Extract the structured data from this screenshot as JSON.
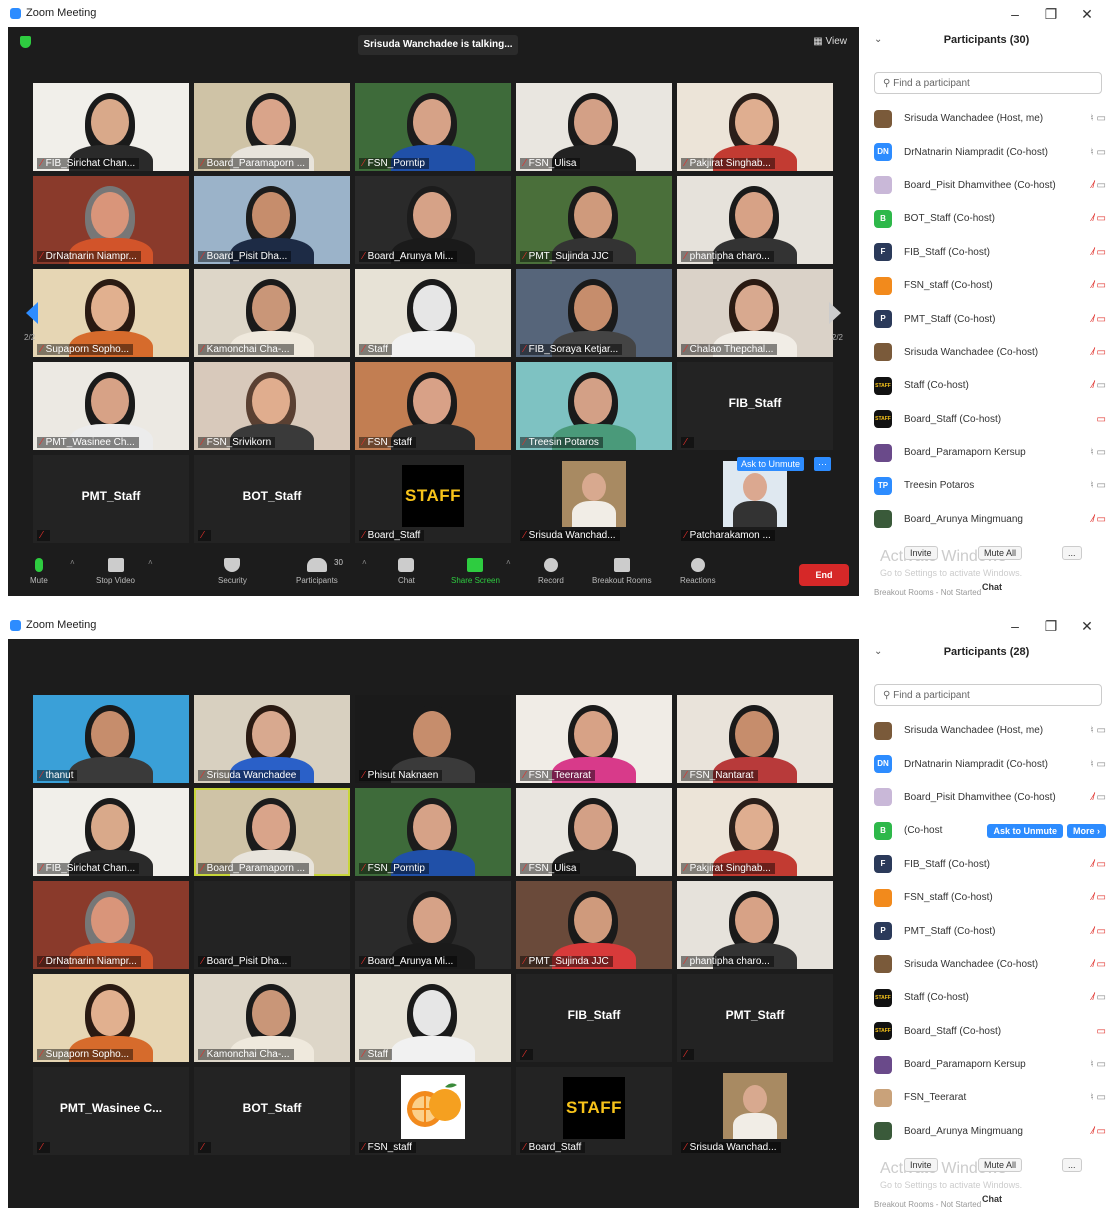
{
  "window": {
    "title": "Zoom Meeting"
  },
  "screen1": {
    "talking": "Srisuda Wanchadee is talking...",
    "view_label": "View",
    "page_left": "2/2",
    "page_right": "2/2",
    "tiles": [
      {
        "name": "FIB_Sirichat Chan...",
        "type": "video",
        "skin": "#d9a98a",
        "bg": "#f1efea",
        "hair": "#1a1a1a",
        "shirt": "#2a2a2a"
      },
      {
        "name": "Board_Paramaporn ...",
        "type": "video",
        "skin": "#d9a48a",
        "bg": "#cfc3a6",
        "hair": "#1c1c1c",
        "shirt": "#e8e4dc"
      },
      {
        "name": "FSN_Porntip",
        "type": "video",
        "skin": "#d6a287",
        "bg": "#3e6b3a",
        "hair": "#1c1c1c",
        "shirt": "#2050a8"
      },
      {
        "name": "FSN_Ulisa",
        "type": "video",
        "skin": "#d3a086",
        "bg": "#e9e6e0",
        "hair": "#1a1a1a",
        "shirt": "#222"
      },
      {
        "name": "Pakjirat Singhab...",
        "type": "video",
        "skin": "#dfae90",
        "bg": "#ece4d8",
        "hair": "#2a1f1a",
        "shirt": "#c23b32"
      },
      {
        "name": "DrNatnarin Niampr...",
        "type": "video",
        "skin": "#d9957a",
        "bg": "#8a3a2b",
        "hair": "#777",
        "shirt": "#d2542a"
      },
      {
        "name": "Board_Pisit Dha...",
        "type": "video",
        "skin": "#c68d6c",
        "bg": "#9bb3c9",
        "hair": "#1c1c1c",
        "shirt": "#1d2b45"
      },
      {
        "name": "Board_Arunya Mi...",
        "type": "video",
        "skin": "#d6a287",
        "bg": "#2a2a2a",
        "hair": "#1c1c1c",
        "shirt": "#1a1a1a"
      },
      {
        "name": "PMT_Sujinda JJC",
        "type": "video",
        "skin": "#cf9a7c",
        "bg": "#4a6f3a",
        "hair": "#1a1a1a",
        "shirt": "#333"
      },
      {
        "name": "phantipha charo...",
        "type": "video",
        "skin": "#d7a286",
        "bg": "#e6e2db",
        "hair": "#1a1a1a",
        "shirt": "#333"
      },
      {
        "name": "Supaporn Sopho...",
        "type": "video",
        "skin": "#e1b08f",
        "bg": "#e6d6b4",
        "hair": "#2a1a12",
        "shirt": "#d66b2c"
      },
      {
        "name": "Kamonchai Cha-...",
        "type": "video",
        "skin": "#c99678",
        "bg": "#ddd6c8",
        "hair": "#1a1a1a",
        "shirt": "#efe9dd"
      },
      {
        "name": "Staff",
        "type": "video",
        "skin": "#e6e6e6",
        "bg": "#e7e2d6",
        "hair": "#1a1a1a",
        "shirt": "#f1f1f1"
      },
      {
        "name": "FIB_Soraya Ketjar...",
        "type": "video",
        "skin": "#c68d6c",
        "bg": "#56657a",
        "hair": "#1a1a1a",
        "shirt": "#444"
      },
      {
        "name": "Chalao Thepchal...",
        "type": "video",
        "skin": "#d8a98f",
        "bg": "#dad2c8",
        "hair": "#2a1a12",
        "shirt": "#f1ede6"
      },
      {
        "name": "PMT_Wasinee Ch...",
        "type": "video",
        "skin": "#d7a286",
        "bg": "#ece9e3",
        "hair": "#1a1a1a",
        "shirt": "#ececec"
      },
      {
        "name": "FSN_Srivikorn",
        "type": "video",
        "skin": "#e0ad8e",
        "bg": "#d8c9bb",
        "hair": "#5a4032",
        "shirt": "#3a3a3a"
      },
      {
        "name": "FSN_staff",
        "type": "video",
        "skin": "#d8a187",
        "bg": "#c27e52",
        "hair": "#1a1a1a",
        "shirt": "#2a2a2a"
      },
      {
        "name": "Treesin Potaros",
        "type": "video",
        "skin": "#d3a086",
        "bg": "#7ec2c2",
        "hair": "#1a1a1a",
        "shirt": "#4a9a7a"
      },
      {
        "name": "FIB_Staff",
        "type": "name"
      },
      {
        "name": "PMT_Staff",
        "type": "name"
      },
      {
        "name": "BOT_Staff",
        "type": "name"
      },
      {
        "name": "Board_Staff",
        "type": "staff"
      },
      {
        "name": "Srisuda Wanchad...",
        "type": "photo",
        "skin": "#d8a98f",
        "bg": "#a88a62",
        "hair": "#2a1a12",
        "shirt": "#f1ede6"
      },
      {
        "name": "Patcharakamon ...",
        "type": "photo",
        "skin": "#dba890",
        "bg": "#dfe8f0",
        "hair": "#1a1a1a",
        "shirt": "#333"
      }
    ],
    "ask_to_unmute": "Ask to Unmute",
    "more_dots": "···",
    "toolbar": {
      "mute": "Mute",
      "stop_video": "Stop Video",
      "security": "Security",
      "participants": "Participants",
      "participants_count": "30",
      "chat": "Chat",
      "share_screen": "Share Screen",
      "record": "Record",
      "breakout_rooms": "Breakout Rooms",
      "reactions": "Reactions",
      "end": "End"
    },
    "panel": {
      "title": "Participants (30)",
      "search_placeholder": "Find a participant",
      "participants": [
        {
          "name": "Srisuda Wanchadee (Host, me)",
          "av_text": "",
          "av_color": "#7a5a3a",
          "mic": "on",
          "cam": "on"
        },
        {
          "name": "DrNatnarin Niampradit (Co-host)",
          "av_text": "DN",
          "av_color": "#2d8cff",
          "mic": "on",
          "cam": "on"
        },
        {
          "name": "Board_Pisit Dhamvithee (Co-host)",
          "av_text": "",
          "av_color": "#c9b8d8",
          "mic": "off",
          "cam": "on"
        },
        {
          "name": "BOT_Staff (Co-host)",
          "av_text": "B",
          "av_color": "#2eb84a",
          "mic": "off",
          "cam": "off"
        },
        {
          "name": "FIB_Staff (Co-host)",
          "av_text": "F",
          "av_color": "#2b3a5a",
          "mic": "off",
          "cam": "off"
        },
        {
          "name": "FSN_staff (Co-host)",
          "av_text": "",
          "av_color": "#f28a1c",
          "mic": "off",
          "cam": "off"
        },
        {
          "name": "PMT_Staff (Co-host)",
          "av_text": "P",
          "av_color": "#2b3a5a",
          "mic": "off",
          "cam": "off"
        },
        {
          "name": "Srisuda Wanchadee (Co-host)",
          "av_text": "",
          "av_color": "#7a5a3a",
          "mic": "off",
          "cam": "off"
        },
        {
          "name": "Staff (Co-host)",
          "av_text": "STAFF",
          "av_color": "#111111",
          "mic": "off",
          "cam": "on"
        },
        {
          "name": "Board_Staff (Co-host)",
          "av_text": "STAFF",
          "av_color": "#111111",
          "mic": "",
          "cam": "off"
        },
        {
          "name": "Board_Paramaporn Kersup",
          "av_text": "",
          "av_color": "#6a4a8a",
          "mic": "on",
          "cam": "on"
        },
        {
          "name": "Treesin Potaros",
          "av_text": "TP",
          "av_color": "#2d8cff",
          "mic": "on",
          "cam": "on"
        },
        {
          "name": "Board_Arunya Mingmuang",
          "av_text": "",
          "av_color": "#3a5a3a",
          "mic": "off",
          "cam": "off"
        }
      ],
      "activate": "Activate Windows",
      "goto": "Go to Settings to activate Windows.",
      "invite": "Invite",
      "mute_all": "Mute All",
      "more": "...",
      "chat": "Chat",
      "breakout": "Breakout Rooms - Not Started"
    }
  },
  "screen2": {
    "tiles": [
      {
        "name": "thanut",
        "type": "video",
        "skin": "#c68d6c",
        "bg": "#3aa0d8",
        "hair": "#1a1a1a",
        "shirt": "#3a3a3a"
      },
      {
        "name": "Srisuda Wanchadee",
        "type": "video",
        "skin": "#d8a98f",
        "bg": "#d8d0c0",
        "hair": "#2a1a12",
        "shirt": "#2a60c8"
      },
      {
        "name": "Phisut Naknaen",
        "type": "video",
        "skin": "#c68d6c",
        "bg": "#1a1a1a",
        "hair": "#1a1a1a",
        "shirt": "#3a3a3a"
      },
      {
        "name": "FSN_Teerarat",
        "type": "video",
        "skin": "#d7a286",
        "bg": "#f0ece6",
        "hair": "#1a1a1a",
        "shirt": "#d83a8a"
      },
      {
        "name": "FSN_Nantarat",
        "type": "video",
        "skin": "#c68d6c",
        "bg": "#e9e3da",
        "hair": "#1a1a1a",
        "shirt": "#b83a3a"
      },
      {
        "name": "FIB_Sirichat Chan...",
        "type": "video",
        "skin": "#d9a98a",
        "bg": "#f1efea",
        "hair": "#1a1a1a",
        "shirt": "#2a2a2a"
      },
      {
        "name": "Board_Paramaporn ...",
        "type": "video",
        "skin": "#d9a48a",
        "bg": "#cfc3a6",
        "hair": "#1c1c1c",
        "shirt": "#e8e4dc",
        "highlight": true
      },
      {
        "name": "FSN_Porntip",
        "type": "video",
        "skin": "#d6a287",
        "bg": "#3e6b3a",
        "hair": "#1c1c1c",
        "shirt": "#2050a8"
      },
      {
        "name": "FSN_Ulisa",
        "type": "video",
        "skin": "#d3a086",
        "bg": "#e9e6e0",
        "hair": "#1a1a1a",
        "shirt": "#222"
      },
      {
        "name": "Pakjirat Singhab...",
        "type": "video",
        "skin": "#dfae90",
        "bg": "#ece4d8",
        "hair": "#2a1f1a",
        "shirt": "#c23b32"
      },
      {
        "name": "DrNatnarin Niampr...",
        "type": "video",
        "skin": "#d9957a",
        "bg": "#8a3a2b",
        "hair": "#777",
        "shirt": "#d2542a"
      },
      {
        "name": "Board_Pisit Dha...",
        "type": "blank"
      },
      {
        "name": "Board_Arunya Mi...",
        "type": "video",
        "skin": "#d6a287",
        "bg": "#2a2a2a",
        "hair": "#1c1c1c",
        "shirt": "#1a1a1a"
      },
      {
        "name": "PMT_Sujinda JJC",
        "type": "video",
        "skin": "#cf9a7c",
        "bg": "#6a4a3a",
        "hair": "#1a1a1a",
        "shirt": "#d83a3a"
      },
      {
        "name": "phantipha charo...",
        "type": "video",
        "skin": "#d7a286",
        "bg": "#e6e2db",
        "hair": "#1a1a1a",
        "shirt": "#333"
      },
      {
        "name": "Supaporn Sopho...",
        "type": "video",
        "skin": "#e1b08f",
        "bg": "#e6d6b4",
        "hair": "#2a1a12",
        "shirt": "#d66b2c"
      },
      {
        "name": "Kamonchai Cha-...",
        "type": "video",
        "skin": "#c99678",
        "bg": "#ddd6c8",
        "hair": "#1a1a1a",
        "shirt": "#efe9dd"
      },
      {
        "name": "Staff",
        "type": "video",
        "skin": "#e6e6e6",
        "bg": "#e7e2d6",
        "hair": "#1a1a1a",
        "shirt": "#f1f1f1"
      },
      {
        "name": "FIB_Staff",
        "type": "name"
      },
      {
        "name": "PMT_Staff",
        "type": "name"
      },
      {
        "name": "PMT_Wasinee C...",
        "type": "name"
      },
      {
        "name": "BOT_Staff",
        "type": "name"
      },
      {
        "name": "FSN_staff",
        "type": "orange"
      },
      {
        "name": "Board_Staff",
        "type": "staff"
      },
      {
        "name": "Srisuda Wanchad...",
        "type": "photo",
        "skin": "#d8a98f",
        "bg": "#a88a62",
        "hair": "#2a1a12",
        "shirt": "#f1ede6"
      }
    ],
    "panel": {
      "title": "Participants (28)",
      "search_placeholder": "Find a participant",
      "participants": [
        {
          "name": "Srisuda Wanchadee (Host, me)",
          "av_text": "",
          "av_color": "#7a5a3a",
          "mic": "on",
          "cam": "on"
        },
        {
          "name": "DrNatnarin Niampradit (Co-host)",
          "av_text": "DN",
          "av_color": "#2d8cff",
          "mic": "on",
          "cam": "on"
        },
        {
          "name": "Board_Pisit Dhamvithee (Co-host)",
          "av_text": "",
          "av_color": "#c9b8d8",
          "mic": "off",
          "cam": "on"
        },
        {
          "name": "(Co-host",
          "av_text": "B",
          "av_color": "#2eb84a",
          "mic": "",
          "cam": "",
          "ask": "Ask to Unmute",
          "more": "More ›"
        },
        {
          "name": "FIB_Staff (Co-host)",
          "av_text": "F",
          "av_color": "#2b3a5a",
          "mic": "off",
          "cam": "off"
        },
        {
          "name": "FSN_staff (Co-host)",
          "av_text": "",
          "av_color": "#f28a1c",
          "mic": "off",
          "cam": "off"
        },
        {
          "name": "PMT_Staff (Co-host)",
          "av_text": "P",
          "av_color": "#2b3a5a",
          "mic": "off",
          "cam": "off"
        },
        {
          "name": "Srisuda Wanchadee (Co-host)",
          "av_text": "",
          "av_color": "#7a5a3a",
          "mic": "off",
          "cam": "off"
        },
        {
          "name": "Staff (Co-host)",
          "av_text": "STAFF",
          "av_color": "#111111",
          "mic": "off",
          "cam": "on"
        },
        {
          "name": "Board_Staff (Co-host)",
          "av_text": "STAFF",
          "av_color": "#111111",
          "mic": "",
          "cam": "off"
        },
        {
          "name": "Board_Paramaporn Kersup",
          "av_text": "",
          "av_color": "#6a4a8a",
          "mic": "on",
          "cam": "on"
        },
        {
          "name": "FSN_Teerarat",
          "av_text": "",
          "av_color": "#c9a27a",
          "mic": "on",
          "cam": "on"
        },
        {
          "name": "Board_Arunya Mingmuang",
          "av_text": "",
          "av_color": "#3a5a3a",
          "mic": "off",
          "cam": "off"
        }
      ],
      "activate": "Activate Windows",
      "goto": "Go to Settings to activate Windows.",
      "invite": "Invite",
      "mute_all": "Mute All",
      "more": "...",
      "chat": "Chat",
      "breakout": "Breakout Rooms - Not Started"
    }
  }
}
